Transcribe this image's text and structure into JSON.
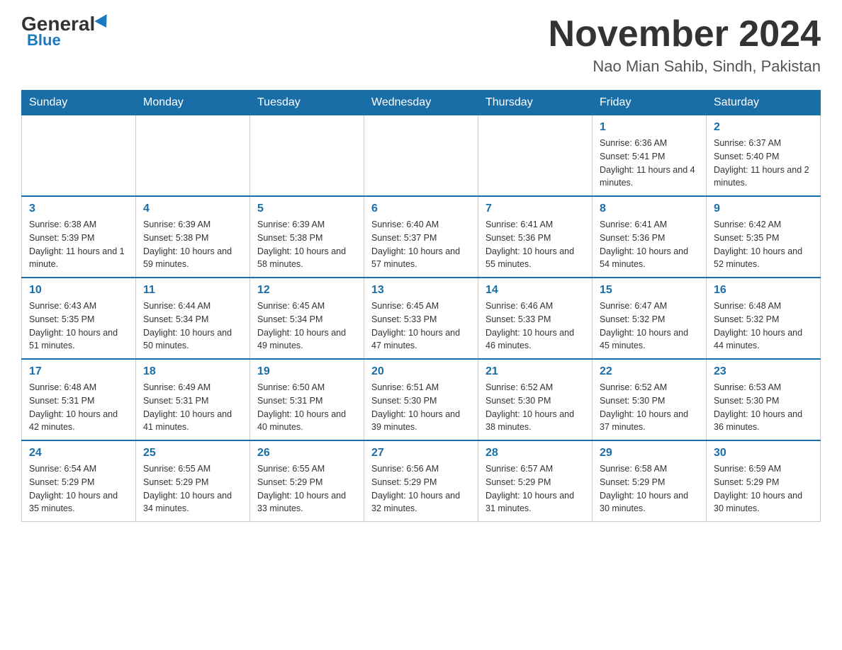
{
  "logo": {
    "general": "General",
    "blue": "Blue"
  },
  "title": "November 2024",
  "subtitle": "Nao Mian Sahib, Sindh, Pakistan",
  "days_of_week": [
    "Sunday",
    "Monday",
    "Tuesday",
    "Wednesday",
    "Thursday",
    "Friday",
    "Saturday"
  ],
  "weeks": [
    [
      {
        "day": "",
        "info": ""
      },
      {
        "day": "",
        "info": ""
      },
      {
        "day": "",
        "info": ""
      },
      {
        "day": "",
        "info": ""
      },
      {
        "day": "",
        "info": ""
      },
      {
        "day": "1",
        "info": "Sunrise: 6:36 AM\nSunset: 5:41 PM\nDaylight: 11 hours and 4 minutes."
      },
      {
        "day": "2",
        "info": "Sunrise: 6:37 AM\nSunset: 5:40 PM\nDaylight: 11 hours and 2 minutes."
      }
    ],
    [
      {
        "day": "3",
        "info": "Sunrise: 6:38 AM\nSunset: 5:39 PM\nDaylight: 11 hours and 1 minute."
      },
      {
        "day": "4",
        "info": "Sunrise: 6:39 AM\nSunset: 5:38 PM\nDaylight: 10 hours and 59 minutes."
      },
      {
        "day": "5",
        "info": "Sunrise: 6:39 AM\nSunset: 5:38 PM\nDaylight: 10 hours and 58 minutes."
      },
      {
        "day": "6",
        "info": "Sunrise: 6:40 AM\nSunset: 5:37 PM\nDaylight: 10 hours and 57 minutes."
      },
      {
        "day": "7",
        "info": "Sunrise: 6:41 AM\nSunset: 5:36 PM\nDaylight: 10 hours and 55 minutes."
      },
      {
        "day": "8",
        "info": "Sunrise: 6:41 AM\nSunset: 5:36 PM\nDaylight: 10 hours and 54 minutes."
      },
      {
        "day": "9",
        "info": "Sunrise: 6:42 AM\nSunset: 5:35 PM\nDaylight: 10 hours and 52 minutes."
      }
    ],
    [
      {
        "day": "10",
        "info": "Sunrise: 6:43 AM\nSunset: 5:35 PM\nDaylight: 10 hours and 51 minutes."
      },
      {
        "day": "11",
        "info": "Sunrise: 6:44 AM\nSunset: 5:34 PM\nDaylight: 10 hours and 50 minutes."
      },
      {
        "day": "12",
        "info": "Sunrise: 6:45 AM\nSunset: 5:34 PM\nDaylight: 10 hours and 49 minutes."
      },
      {
        "day": "13",
        "info": "Sunrise: 6:45 AM\nSunset: 5:33 PM\nDaylight: 10 hours and 47 minutes."
      },
      {
        "day": "14",
        "info": "Sunrise: 6:46 AM\nSunset: 5:33 PM\nDaylight: 10 hours and 46 minutes."
      },
      {
        "day": "15",
        "info": "Sunrise: 6:47 AM\nSunset: 5:32 PM\nDaylight: 10 hours and 45 minutes."
      },
      {
        "day": "16",
        "info": "Sunrise: 6:48 AM\nSunset: 5:32 PM\nDaylight: 10 hours and 44 minutes."
      }
    ],
    [
      {
        "day": "17",
        "info": "Sunrise: 6:48 AM\nSunset: 5:31 PM\nDaylight: 10 hours and 42 minutes."
      },
      {
        "day": "18",
        "info": "Sunrise: 6:49 AM\nSunset: 5:31 PM\nDaylight: 10 hours and 41 minutes."
      },
      {
        "day": "19",
        "info": "Sunrise: 6:50 AM\nSunset: 5:31 PM\nDaylight: 10 hours and 40 minutes."
      },
      {
        "day": "20",
        "info": "Sunrise: 6:51 AM\nSunset: 5:30 PM\nDaylight: 10 hours and 39 minutes."
      },
      {
        "day": "21",
        "info": "Sunrise: 6:52 AM\nSunset: 5:30 PM\nDaylight: 10 hours and 38 minutes."
      },
      {
        "day": "22",
        "info": "Sunrise: 6:52 AM\nSunset: 5:30 PM\nDaylight: 10 hours and 37 minutes."
      },
      {
        "day": "23",
        "info": "Sunrise: 6:53 AM\nSunset: 5:30 PM\nDaylight: 10 hours and 36 minutes."
      }
    ],
    [
      {
        "day": "24",
        "info": "Sunrise: 6:54 AM\nSunset: 5:29 PM\nDaylight: 10 hours and 35 minutes."
      },
      {
        "day": "25",
        "info": "Sunrise: 6:55 AM\nSunset: 5:29 PM\nDaylight: 10 hours and 34 minutes."
      },
      {
        "day": "26",
        "info": "Sunrise: 6:55 AM\nSunset: 5:29 PM\nDaylight: 10 hours and 33 minutes."
      },
      {
        "day": "27",
        "info": "Sunrise: 6:56 AM\nSunset: 5:29 PM\nDaylight: 10 hours and 32 minutes."
      },
      {
        "day": "28",
        "info": "Sunrise: 6:57 AM\nSunset: 5:29 PM\nDaylight: 10 hours and 31 minutes."
      },
      {
        "day": "29",
        "info": "Sunrise: 6:58 AM\nSunset: 5:29 PM\nDaylight: 10 hours and 30 minutes."
      },
      {
        "day": "30",
        "info": "Sunrise: 6:59 AM\nSunset: 5:29 PM\nDaylight: 10 hours and 30 minutes."
      }
    ]
  ]
}
